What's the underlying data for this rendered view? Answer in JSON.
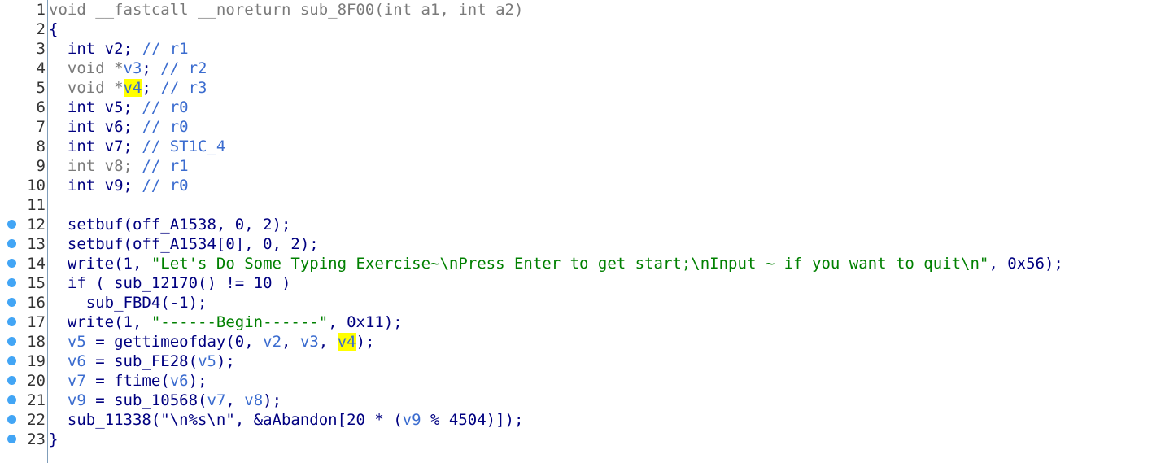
{
  "lines": [
    {
      "n": "1",
      "bp": false,
      "tokens": [
        {
          "t": "void __fastcall __noreturn sub_8F00(int a1, int a2)",
          "c": "kwg"
        }
      ]
    },
    {
      "n": "2",
      "bp": false,
      "tokens": [
        {
          "t": "{",
          "c": "p"
        }
      ]
    },
    {
      "n": "3",
      "bp": false,
      "tokens": [
        {
          "t": "  int v2; ",
          "c": "kw"
        },
        {
          "t": "// r1",
          "c": "cm"
        }
      ]
    },
    {
      "n": "4",
      "bp": false,
      "tokens": [
        {
          "t": "  void *",
          "c": "kwg"
        },
        {
          "t": "v3",
          "c": "var"
        },
        {
          "t": "; ",
          "c": "p"
        },
        {
          "t": "// r2",
          "c": "cm"
        }
      ]
    },
    {
      "n": "5",
      "bp": false,
      "tokens": [
        {
          "t": "  void *",
          "c": "kwg"
        },
        {
          "t": "v4",
          "c": "var hl"
        },
        {
          "t": "; ",
          "c": "p"
        },
        {
          "t": "// r3",
          "c": "cm"
        }
      ]
    },
    {
      "n": "6",
      "bp": false,
      "tokens": [
        {
          "t": "  int v5; ",
          "c": "kw"
        },
        {
          "t": "// r0",
          "c": "cm"
        }
      ]
    },
    {
      "n": "7",
      "bp": false,
      "tokens": [
        {
          "t": "  int v6; ",
          "c": "kw"
        },
        {
          "t": "// r0",
          "c": "cm"
        }
      ]
    },
    {
      "n": "8",
      "bp": false,
      "tokens": [
        {
          "t": "  int v7; ",
          "c": "kw"
        },
        {
          "t": "// ST1C_4",
          "c": "cm"
        }
      ]
    },
    {
      "n": "9",
      "bp": false,
      "tokens": [
        {
          "t": "  int v8; ",
          "c": "kwg"
        },
        {
          "t": "// r1",
          "c": "cm"
        }
      ]
    },
    {
      "n": "10",
      "bp": false,
      "tokens": [
        {
          "t": "  int v9; ",
          "c": "kw"
        },
        {
          "t": "// r0",
          "c": "cm"
        }
      ]
    },
    {
      "n": "11",
      "bp": false,
      "tokens": []
    },
    {
      "n": "12",
      "bp": true,
      "tokens": [
        {
          "t": "  setbuf(off_A1538, 0, 2);",
          "c": "fn"
        }
      ]
    },
    {
      "n": "13",
      "bp": true,
      "tokens": [
        {
          "t": "  setbuf(off_A1534[0], 0, 2);",
          "c": "fn"
        }
      ]
    },
    {
      "n": "14",
      "bp": true,
      "tokens": [
        {
          "t": "  write(1, ",
          "c": "fn"
        },
        {
          "t": "\"Let's Do Some Typing Exercise~\\nPress Enter to get start;\\nInput ~ if you want to quit\\n\"",
          "c": "str"
        },
        {
          "t": ", 0x56);",
          "c": "num"
        }
      ]
    },
    {
      "n": "15",
      "bp": true,
      "tokens": [
        {
          "t": "  if ( sub_12170() != 10 )",
          "c": "fn"
        }
      ]
    },
    {
      "n": "16",
      "bp": true,
      "tokens": [
        {
          "t": "    sub_FBD4(-1);",
          "c": "fn"
        }
      ]
    },
    {
      "n": "17",
      "bp": true,
      "tokens": [
        {
          "t": "  write(1, ",
          "c": "fn"
        },
        {
          "t": "\"------Begin------\"",
          "c": "str"
        },
        {
          "t": ", 0x11);",
          "c": "num"
        }
      ]
    },
    {
      "n": "18",
      "bp": true,
      "tokens": [
        {
          "t": "  ",
          "c": "p"
        },
        {
          "t": "v5",
          "c": "var"
        },
        {
          "t": " = gettimeofday(0, ",
          "c": "fn"
        },
        {
          "t": "v2",
          "c": "var"
        },
        {
          "t": ", ",
          "c": "p"
        },
        {
          "t": "v3",
          "c": "var"
        },
        {
          "t": ", ",
          "c": "p"
        },
        {
          "t": "v4",
          "c": "var hl"
        },
        {
          "t": ");",
          "c": "p"
        }
      ]
    },
    {
      "n": "19",
      "bp": true,
      "tokens": [
        {
          "t": "  ",
          "c": "p"
        },
        {
          "t": "v6",
          "c": "var"
        },
        {
          "t": " = sub_FE28(",
          "c": "fn"
        },
        {
          "t": "v5",
          "c": "var"
        },
        {
          "t": ");",
          "c": "p"
        }
      ]
    },
    {
      "n": "20",
      "bp": true,
      "tokens": [
        {
          "t": "  ",
          "c": "p"
        },
        {
          "t": "v7",
          "c": "var"
        },
        {
          "t": " = ftime(",
          "c": "fn"
        },
        {
          "t": "v6",
          "c": "var"
        },
        {
          "t": ");",
          "c": "p"
        }
      ]
    },
    {
      "n": "21",
      "bp": true,
      "tokens": [
        {
          "t": "  ",
          "c": "p"
        },
        {
          "t": "v9",
          "c": "var"
        },
        {
          "t": " = sub_10568(",
          "c": "fn"
        },
        {
          "t": "v7",
          "c": "var"
        },
        {
          "t": ", ",
          "c": "p"
        },
        {
          "t": "v8",
          "c": "var"
        },
        {
          "t": ");",
          "c": "p"
        }
      ]
    },
    {
      "n": "22",
      "bp": true,
      "tokens": [
        {
          "t": "  sub_11338(",
          "c": "fn"
        },
        {
          "t": "\"\\n%s\\n\"",
          "c": "fn"
        },
        {
          "t": ", &aAbandon[20 * (",
          "c": "fn"
        },
        {
          "t": "v9",
          "c": "var"
        },
        {
          "t": " % 4504)]);",
          "c": "fn"
        }
      ]
    },
    {
      "n": "23",
      "bp": true,
      "tokens": [
        {
          "t": "}",
          "c": "p"
        }
      ]
    }
  ]
}
